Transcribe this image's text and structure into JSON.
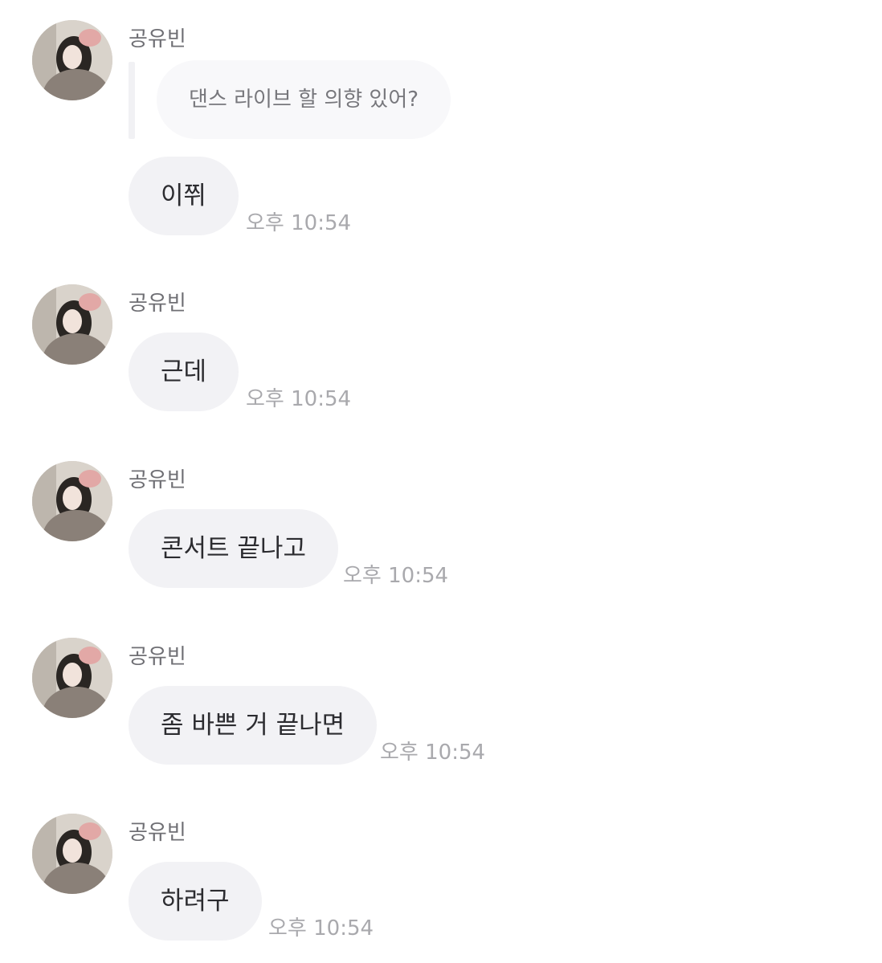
{
  "accent_colors": {
    "bubble_bg": "#f2f2f5",
    "quote_bg": "#f8f8fa",
    "name_text": "#6f6f74",
    "timestamp_text": "#a9a9ad",
    "message_text": "#2c2c30"
  },
  "messages": [
    {
      "sender": "공유빈",
      "avatar_icon": "profile-photo",
      "quoted": "댄스 라이브 할 의향 있어?",
      "text": "이쮜",
      "time": "오후 10:54"
    },
    {
      "sender": "공유빈",
      "avatar_icon": "profile-photo",
      "text": "근데",
      "time": "오후 10:54"
    },
    {
      "sender": "공유빈",
      "avatar_icon": "profile-photo",
      "text": "콘서트 끝나고",
      "time": "오후 10:54"
    },
    {
      "sender": "공유빈",
      "avatar_icon": "profile-photo",
      "text": "좀 바쁜 거 끝나면",
      "time": "오후 10:54"
    },
    {
      "sender": "공유빈",
      "avatar_icon": "profile-photo",
      "text": "하려구",
      "time": "오후 10:54"
    }
  ]
}
